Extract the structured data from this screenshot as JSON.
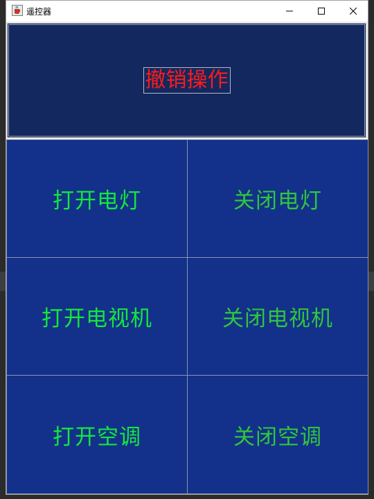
{
  "window": {
    "title": "遥控器",
    "icon": "java-cup-icon",
    "controls": [
      "minimize-icon",
      "maximize-icon",
      "close-icon"
    ]
  },
  "undo": {
    "label": "撤销操作",
    "color": "#ff1a1a",
    "background": "#13285f"
  },
  "buttons": [
    {
      "label": "打开电灯",
      "kind": "on"
    },
    {
      "label": "关闭电灯",
      "kind": "off"
    },
    {
      "label": "打开电视机",
      "kind": "on"
    },
    {
      "label": "关闭电视机",
      "kind": "off"
    },
    {
      "label": "打开空调",
      "kind": "on"
    },
    {
      "label": "关闭空调",
      "kind": "off"
    }
  ],
  "colors": {
    "button_background": "#13318a",
    "on_text": "#12e83c",
    "off_text": "#2fc63c"
  }
}
